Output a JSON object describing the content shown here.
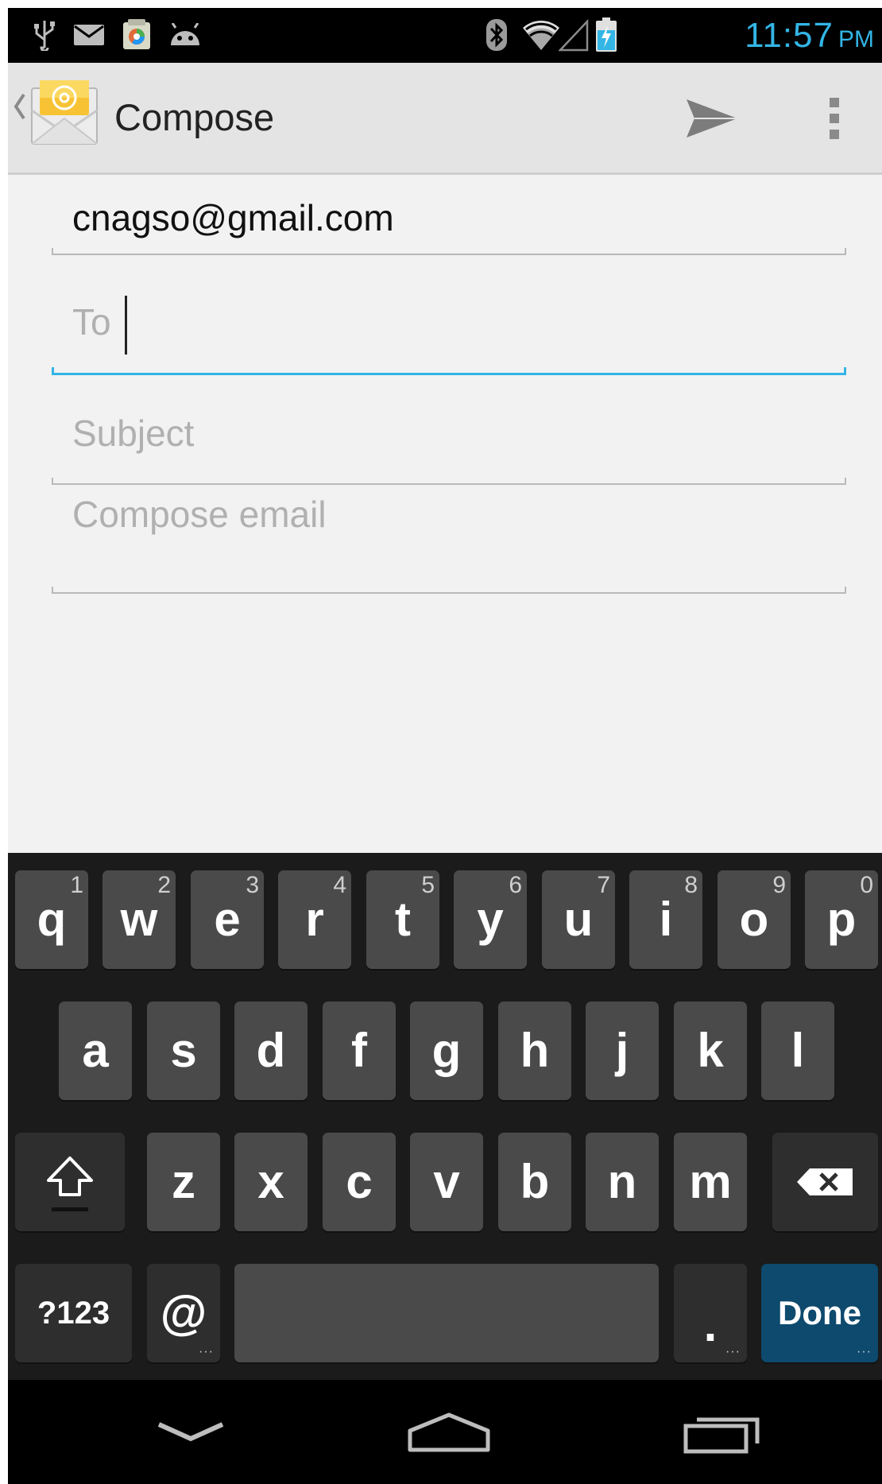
{
  "status_bar": {
    "time": "11:57",
    "ampm": "PM",
    "icons": [
      "usb-icon",
      "mail-icon",
      "app-store-icon",
      "android-icon",
      "bluetooth-icon",
      "wifi-icon",
      "cell-signal-icon",
      "battery-charging-icon"
    ]
  },
  "action_bar": {
    "title": "Compose",
    "app_icon": "email-app-icon",
    "actions": [
      "send-icon",
      "overflow-menu-icon"
    ]
  },
  "form": {
    "from_value": "cnagso@gmail.com",
    "to_placeholder": "To",
    "subject_placeholder": "Subject",
    "body_placeholder": "Compose email"
  },
  "keyboard": {
    "row1": [
      {
        "ch": "q",
        "num": "1"
      },
      {
        "ch": "w",
        "num": "2"
      },
      {
        "ch": "e",
        "num": "3"
      },
      {
        "ch": "r",
        "num": "4"
      },
      {
        "ch": "t",
        "num": "5"
      },
      {
        "ch": "y",
        "num": "6"
      },
      {
        "ch": "u",
        "num": "7"
      },
      {
        "ch": "i",
        "num": "8"
      },
      {
        "ch": "o",
        "num": "9"
      },
      {
        "ch": "p",
        "num": "0"
      }
    ],
    "row2": [
      "a",
      "s",
      "d",
      "f",
      "g",
      "h",
      "j",
      "k",
      "l"
    ],
    "row3": [
      "z",
      "x",
      "c",
      "v",
      "b",
      "n",
      "m"
    ],
    "symbols_label": "?123",
    "at_label": "@",
    "period_label": ".",
    "done_label": "Done"
  },
  "colors": {
    "accent": "#33b5e5",
    "done_key": "#0e4a6e",
    "key": "#4a4a4a",
    "keyboard_bg": "#1b1b1b"
  }
}
